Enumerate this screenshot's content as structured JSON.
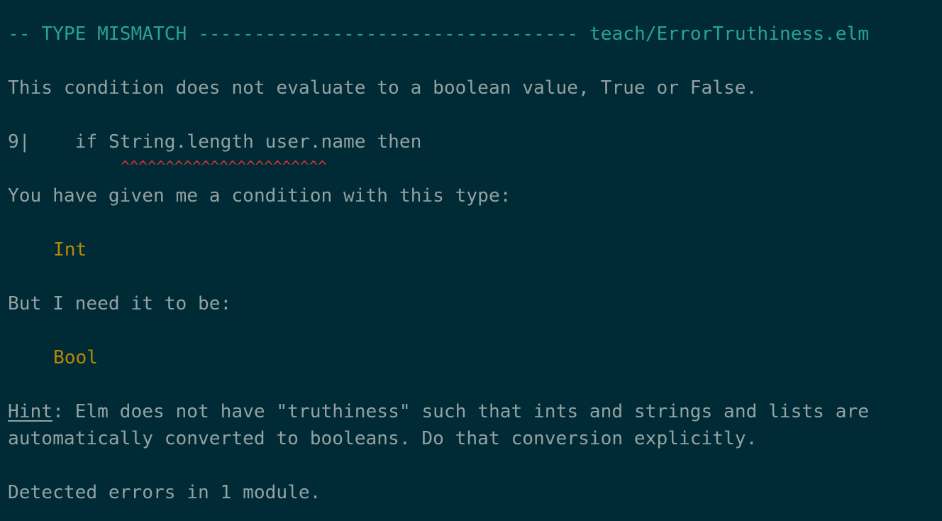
{
  "header": {
    "dashes_left": "--",
    "title": "TYPE MISMATCH",
    "dashes_right": "----------------------------------",
    "file": "teach/ErrorTruthiness.elm"
  },
  "message": "This condition does not evaluate to a boolean value, True or False.",
  "code": {
    "line_number": "9|",
    "indent": "    ",
    "keyword": "if",
    "expr": "String.length user.name",
    "after": "then",
    "marker": "^^^^^^^^^^^^^^^^^^^^^^^"
  },
  "given_text": "You have given me a condition with this type:",
  "given_type": "Int",
  "need_text": "But I need it to be:",
  "need_type": "Bool",
  "hint": {
    "label": "Hint",
    "line1": ": Elm does not have \"truthiness\" such that ints and strings and lists are",
    "line2": "automatically converted to booleans. Do that conversion explicitly."
  },
  "summary": "Detected errors in 1 module.",
  "colors": {
    "background": "#002b36",
    "text": "#93a1a1",
    "header": "#2aa198",
    "type": "#b58900",
    "error_marker": "#dc322f"
  }
}
